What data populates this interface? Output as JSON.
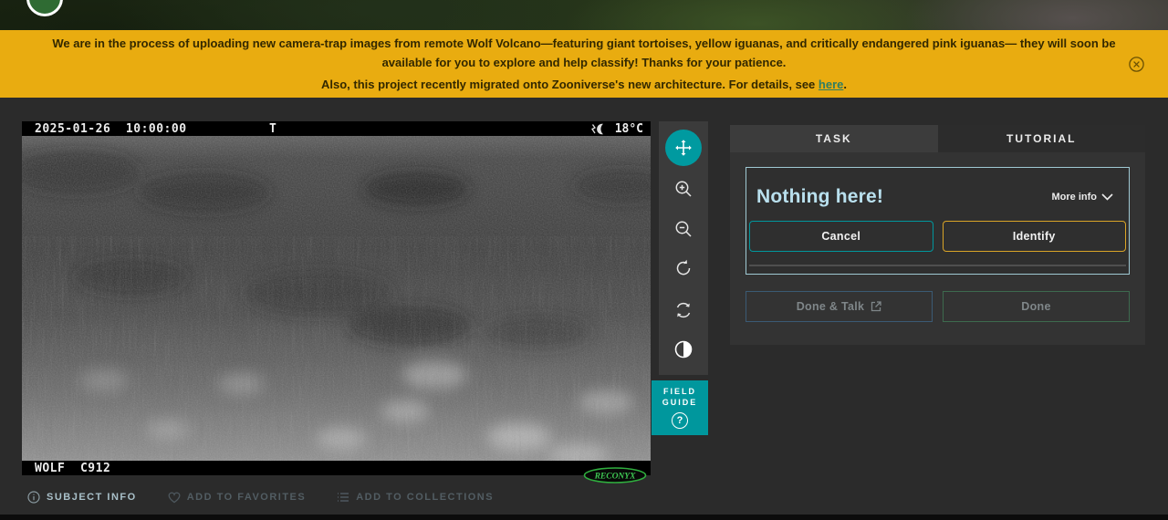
{
  "banner": {
    "line1": "We are in the process of uploading new camera-trap images from remote Wolf Volcano—featuring giant tortoises, yellow iguanas, and critically endangered pink iguanas— they will soon be available for you to explore and help classify! Thanks for your patience.",
    "line2_prefix": "Also, this project recently migrated onto Zooniverse's new architecture. For details, see ",
    "line2_link": "here",
    "line2_suffix": ".",
    "bg_color": "#e9ac10",
    "text_color": "#332800",
    "link_color": "#2e7d64"
  },
  "viewer": {
    "timestamp": "2025-01-26  10:00:00",
    "marker": "T",
    "temperature": "18°C",
    "camera_id": "WOLF  C912",
    "brand": "RECONYX"
  },
  "toolbar": {
    "tools": [
      "pan",
      "zoom-in",
      "zoom-out",
      "rotate",
      "reset-rotation",
      "invert-colors"
    ],
    "active_tool": "pan",
    "field_guide_line1": "FIELD",
    "field_guide_line2": "GUIDE",
    "teal": "#00979d"
  },
  "panel": {
    "tab_task": "TASK",
    "tab_tutorial": "TUTORIAL",
    "question": "Nothing here!",
    "more_info": "More info",
    "cancel": "Cancel",
    "identify": "Identify",
    "done_talk": "Done & Talk",
    "done": "Done",
    "identify_color": "#d9a427",
    "box_border_color": "#9fc9d3",
    "question_color": "#b9e0ee"
  },
  "footer": {
    "subject_info": "SUBJECT INFO",
    "add_favorites": "ADD TO FAVORITES",
    "add_collections": "ADD TO COLLECTIONS"
  }
}
